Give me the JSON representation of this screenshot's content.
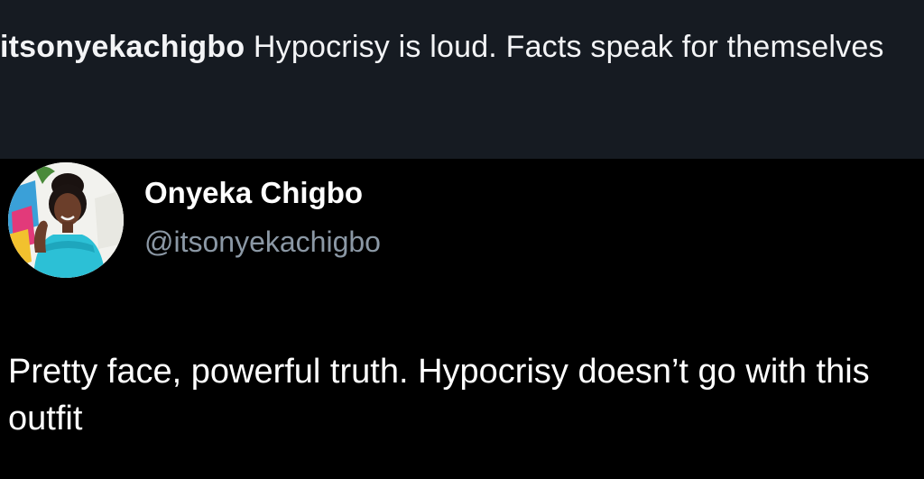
{
  "caption": {
    "username": "itsonyekachigbo",
    "text": " Hypocrisy is loud. Facts speak for themselves"
  },
  "tweet": {
    "display_name": "Onyeka Chigbo",
    "handle": "@itsonyekachigbo",
    "text": "Pretty face, powerful truth. Hypocrisy doesn’t go with this outfit",
    "avatar_icon": "profile-photo"
  },
  "colors": {
    "caption_background": "#161b22",
    "tweet_background": "#000000",
    "primary_text": "#ffffff",
    "secondary_text": "#8b98a5",
    "dress_accent": "#2cc0d6"
  }
}
